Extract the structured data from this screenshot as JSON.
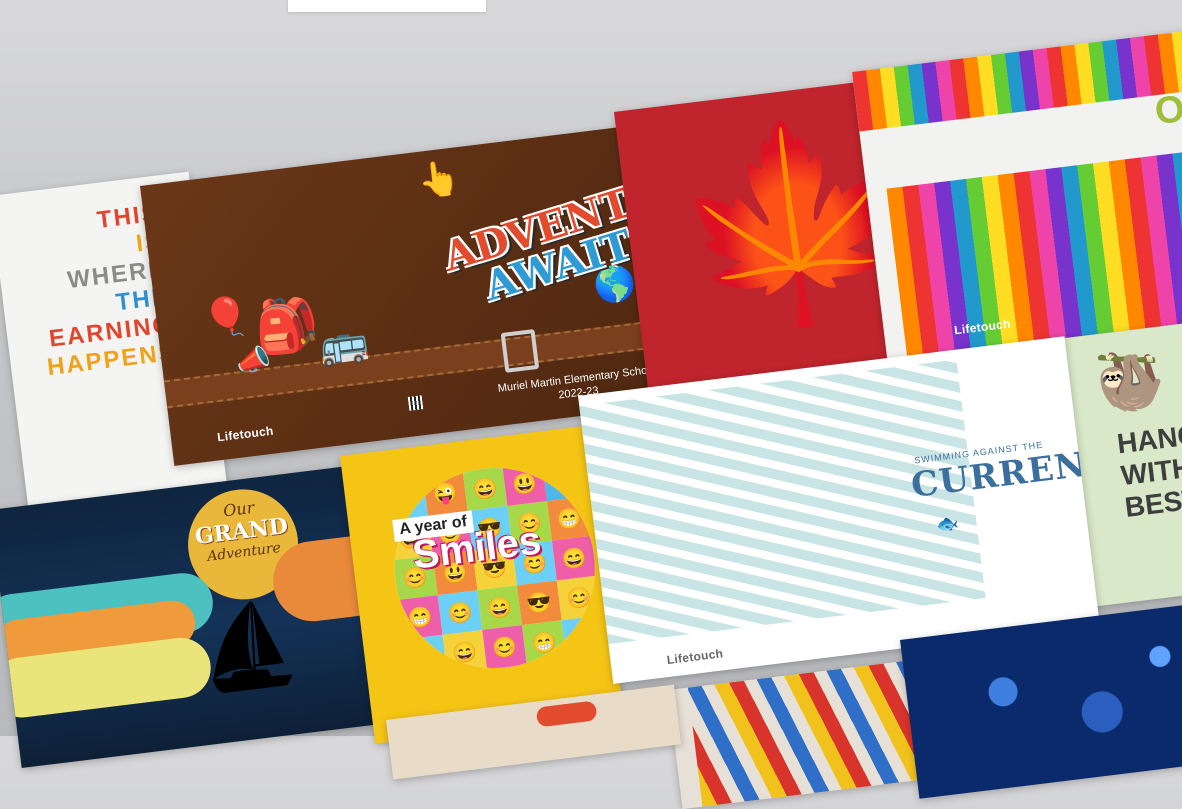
{
  "cards": {
    "learning": {
      "lines": [
        {
          "text": "THIS",
          "color": "#e0462e"
        },
        {
          "text": "IS",
          "color": "#f0a318"
        },
        {
          "text": "WHERE",
          "color": "#8a8a8a"
        },
        {
          "text": "THE",
          "color": "#2f8fcf"
        },
        {
          "text": "EARNING",
          "color": "#e0462e"
        },
        {
          "text": "HAPPENS",
          "color": "#f0a318"
        }
      ]
    },
    "adventure": {
      "title_line1": "ADVENTURE",
      "title_line2": "AWAITS",
      "school_name": "Muriel Martin Elementary School",
      "school_year": "2022-23",
      "brand": "Lifetouch"
    },
    "crayons": {
      "brand": "Lifetouch",
      "partial_word": "OU"
    },
    "grand": {
      "line1": "Our",
      "line2": "GRAND",
      "line3": "Adventure"
    },
    "smiles": {
      "prefix": "A year of",
      "word": "Smiles"
    },
    "current": {
      "small": "SWIMMING AGAINST THE",
      "word": "CURRENT",
      "brand": "Lifetouch"
    },
    "sloth": {
      "line1": "HANG",
      "line2": "WITH",
      "line3": "BESTI"
    }
  },
  "colors": {
    "leather": "#5a2e14",
    "canada_red": "#c0242c",
    "smiles_yellow": "#f5c515",
    "night_navy": "#0f2540"
  }
}
